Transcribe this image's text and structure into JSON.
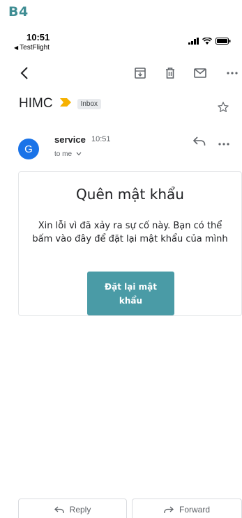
{
  "step_label": "B4",
  "status_bar": {
    "time": "10:51",
    "back_app": "TestFlight"
  },
  "toolbar": {
    "back_icon": "chevron-left-icon",
    "archive_icon": "archive-icon",
    "delete_icon": "trash-icon",
    "mark_unread_icon": "mail-icon",
    "more_icon": "more-horizontal-icon"
  },
  "message": {
    "subject": "HIMC",
    "label": "Inbox",
    "sender": "service",
    "time": "10:51",
    "recipient": "to me"
  },
  "email_card": {
    "title": "Quên mật khẩu",
    "body": "Xin lỗi vì đã xảy ra sự cố này. Bạn có thể bấm vào đây để đặt lại mật khẩu của mình",
    "button_label": "Đặt lại mật khẩu",
    "button_color": "#4a9ba6"
  },
  "avatar_letter": "G",
  "bottom_actions": {
    "reply": "Reply",
    "forward": "Forward"
  },
  "colors": {
    "accent": "#3f8d93",
    "avatar": "#1a73e8",
    "importance": "#f6b100"
  }
}
